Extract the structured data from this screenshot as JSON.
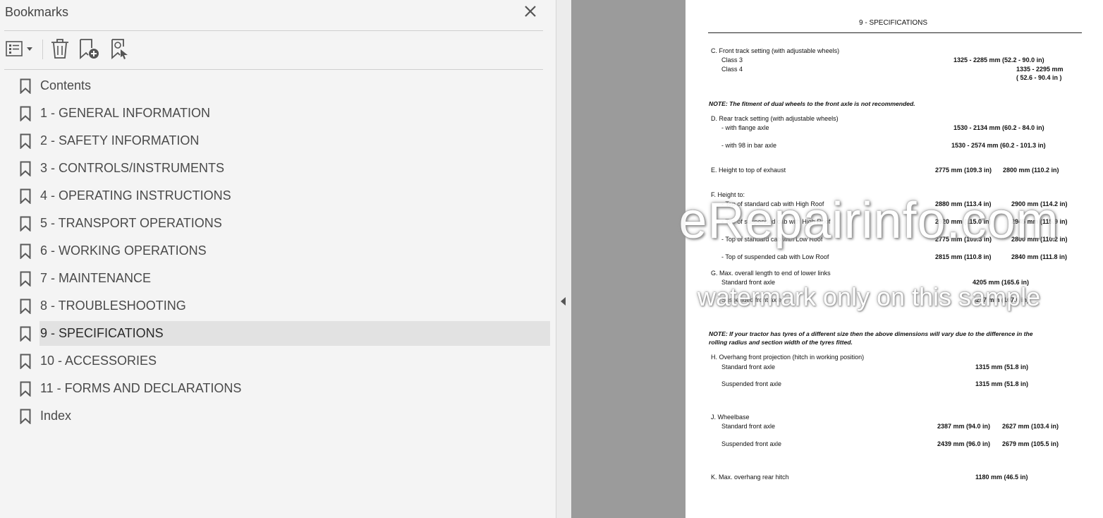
{
  "panel": {
    "title": "Bookmarks",
    "close_icon": "close-icon"
  },
  "toolbar": {
    "options_icon": "bookmark-options-icon",
    "delete_icon": "trash-icon",
    "new_icon": "new-bookmark-icon",
    "find_icon": "find-bookmark-icon"
  },
  "bookmarks": [
    {
      "label": "Contents",
      "selected": false
    },
    {
      "label": "1 - GENERAL INFORMATION",
      "selected": false
    },
    {
      "label": "2 - SAFETY INFORMATION",
      "selected": false
    },
    {
      "label": "3 - CONTROLS/INSTRUMENTS",
      "selected": false
    },
    {
      "label": "4 - OPERATING INSTRUCTIONS",
      "selected": false
    },
    {
      "label": "5 - TRANSPORT OPERATIONS",
      "selected": false
    },
    {
      "label": "6 - WORKING OPERATIONS",
      "selected": false
    },
    {
      "label": "7 - MAINTENANCE",
      "selected": false
    },
    {
      "label": "8 - TROUBLESHOOTING",
      "selected": false
    },
    {
      "label": "9 - SPECIFICATIONS",
      "selected": true
    },
    {
      "label": "10 - ACCESSORIES",
      "selected": false
    },
    {
      "label": "11 - FORMS AND DECLARATIONS",
      "selected": false
    },
    {
      "label": "Index",
      "selected": false
    }
  ],
  "document": {
    "header": "9 - SPECIFICATIONS",
    "c_title": "C.  Front track setting (with adjustable wheels)",
    "c_class3": "Class 3",
    "c_class3_val": "1325 - 2285 mm (52.2 - 90.0 in)",
    "c_class4": "Class 4",
    "c_class4_val1": "1335 - 2295 mm",
    "c_class4_val2": "( 52.6 - 90.4 in )",
    "note1": "NOTE: The fitment of dual wheels to the front axle is not recommended.",
    "d_title": "D.  Rear track setting (with adjustable wheels)",
    "d_flange": "- with flange axle",
    "d_flange_val": "1530 - 2134 mm (60.2 - 84.0 in)",
    "d_bar": "- with 98 in bar axle",
    "d_bar_val": "1530 - 2574 mm (60.2 - 101.3 in)",
    "e_title": "E.  Height to top of exhaust",
    "e_val1": "2775 mm (109.3 in)",
    "e_val2": "2800 mm (110.2 in)",
    "f_title": "F.  Height to:",
    "f_rows": [
      {
        "label": "- Top of standard cab with High Roof",
        "v1": "2880 mm (113.4 in)",
        "v2": "2900 mm (114.2 in)"
      },
      {
        "label": "- Top of suspended cab with High Roof",
        "v1": "2920 mm (115.0 in)",
        "v2": "2945 mm (115.9 in)"
      },
      {
        "label": "- Top of standard cab with Low Roof",
        "v1": "2775 mm (109.3 in)",
        "v2": "2800 mm (110.2 in)"
      },
      {
        "label": "- Top of suspended cab with Low Roof",
        "v1": "2815 mm (110.8 in)",
        "v2": "2840 mm (111.8 in)"
      }
    ],
    "g_title": "G.  Max. overall length to end of lower links",
    "g_std": "Standard front axle",
    "g_std_val": "4205 mm (165.6 in)",
    "g_susp": "Suspended front axle",
    "g_susp_val": "4257 mm (167.6 in)",
    "note2_line1": "NOTE: If your tractor has tyres of a different size then the above dimensions will vary due to the difference in the",
    "note2_line2": "rolling radius and section width of the tyres fitted.",
    "h_title": "H.  Overhang front projection (hitch in working position)",
    "h_std": "Standard front axle",
    "h_std_val": "1315 mm (51.8 in)",
    "h_susp": "Suspended front axle",
    "h_susp_val": "1315 mm (51.8 in)",
    "j_title": "J.  Wheelbase",
    "j_std": "Standard front axle",
    "j_std_v1": "2387 mm (94.0 in)",
    "j_std_v2": "2627 mm (103.4 in)",
    "j_susp": "Suspended front axle",
    "j_susp_v1": "2439 mm (96.0 in)",
    "j_susp_v2": "2679 mm (105.5 in)",
    "k_title": "K.  Max. overhang rear hitch",
    "k_val": "1180 mm (46.5 in)"
  },
  "watermark": {
    "line1": "eRepairinfo.com",
    "line2": "watermark only on this sample"
  },
  "colors": {
    "selected_bg": "#e2e2e2",
    "viewer_bg": "#9b9b9b"
  }
}
